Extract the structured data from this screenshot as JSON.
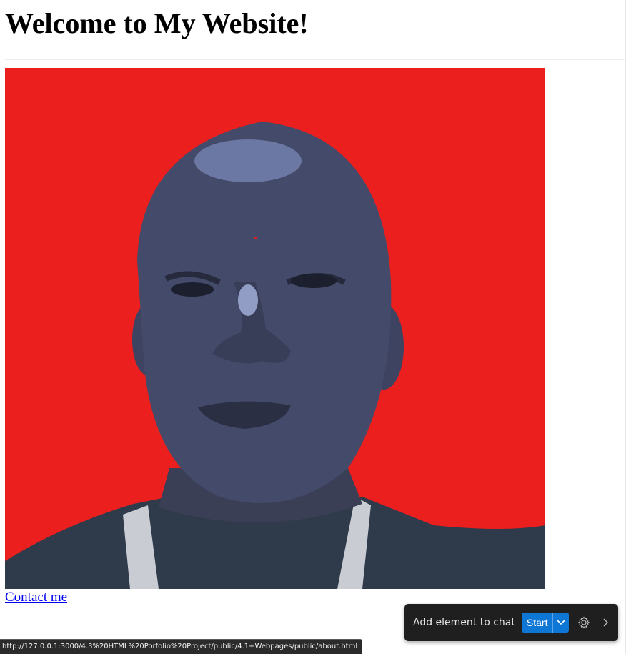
{
  "page": {
    "title": "Welcome to My Website!",
    "photo_alt": "Profile photo",
    "contact_link": "Contact me"
  },
  "status_bar": {
    "url": "http://127.0.0.1:3000/4.3%20HTML%20Porfolio%20Project/public/4.1+Webpages/public/about.html"
  },
  "chat_toolbar": {
    "label": "Add element to chat",
    "start_label": "Start",
    "icons": {
      "dropdown": "chevron-down-icon",
      "settings": "gear-icon",
      "expand": "chevron-right-icon"
    },
    "accent_color": "#0e76d4"
  },
  "colors": {
    "photo_background": "#ec1f1f",
    "link": "#0000ee"
  }
}
